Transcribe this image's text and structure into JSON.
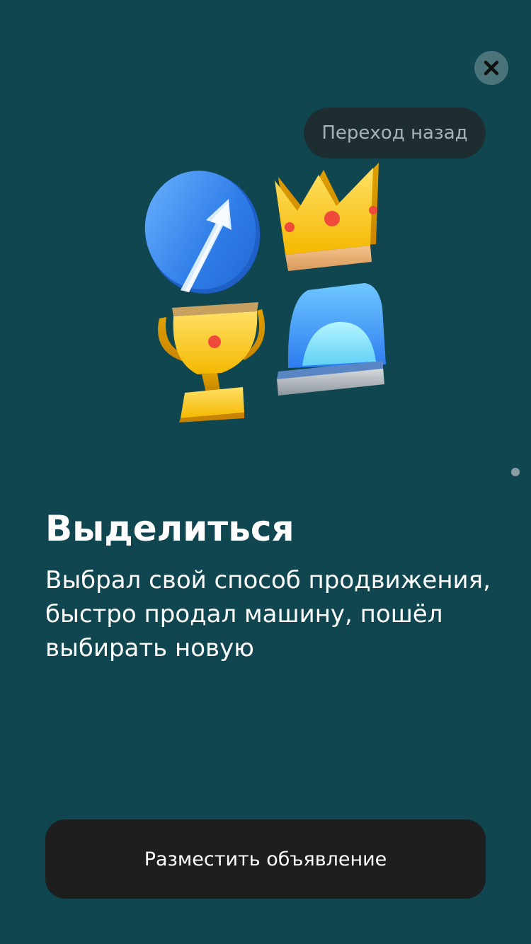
{
  "colors": {
    "background": "#0f4650",
    "close_button_bg": "#4a7479",
    "tooltip_bg": "#1e2d2f",
    "tooltip_text": "#a7b3b5",
    "cta_bg": "#1e1e1f",
    "text": "#ffffff"
  },
  "top_bar": {
    "close_icon": "close-icon",
    "back_tooltip_label": "Переход назад"
  },
  "illustration": {
    "items": [
      "arrow-up-circle-icon",
      "crown-icon",
      "trophy-icon",
      "beacon-light-icon"
    ]
  },
  "pager": {
    "current": 1
  },
  "content": {
    "title": "Выделиться",
    "description": "Выбрал свой способ продвижения, быстро продал машину, пошёл выбирать новую"
  },
  "cta": {
    "label": "Разместить объявление"
  }
}
